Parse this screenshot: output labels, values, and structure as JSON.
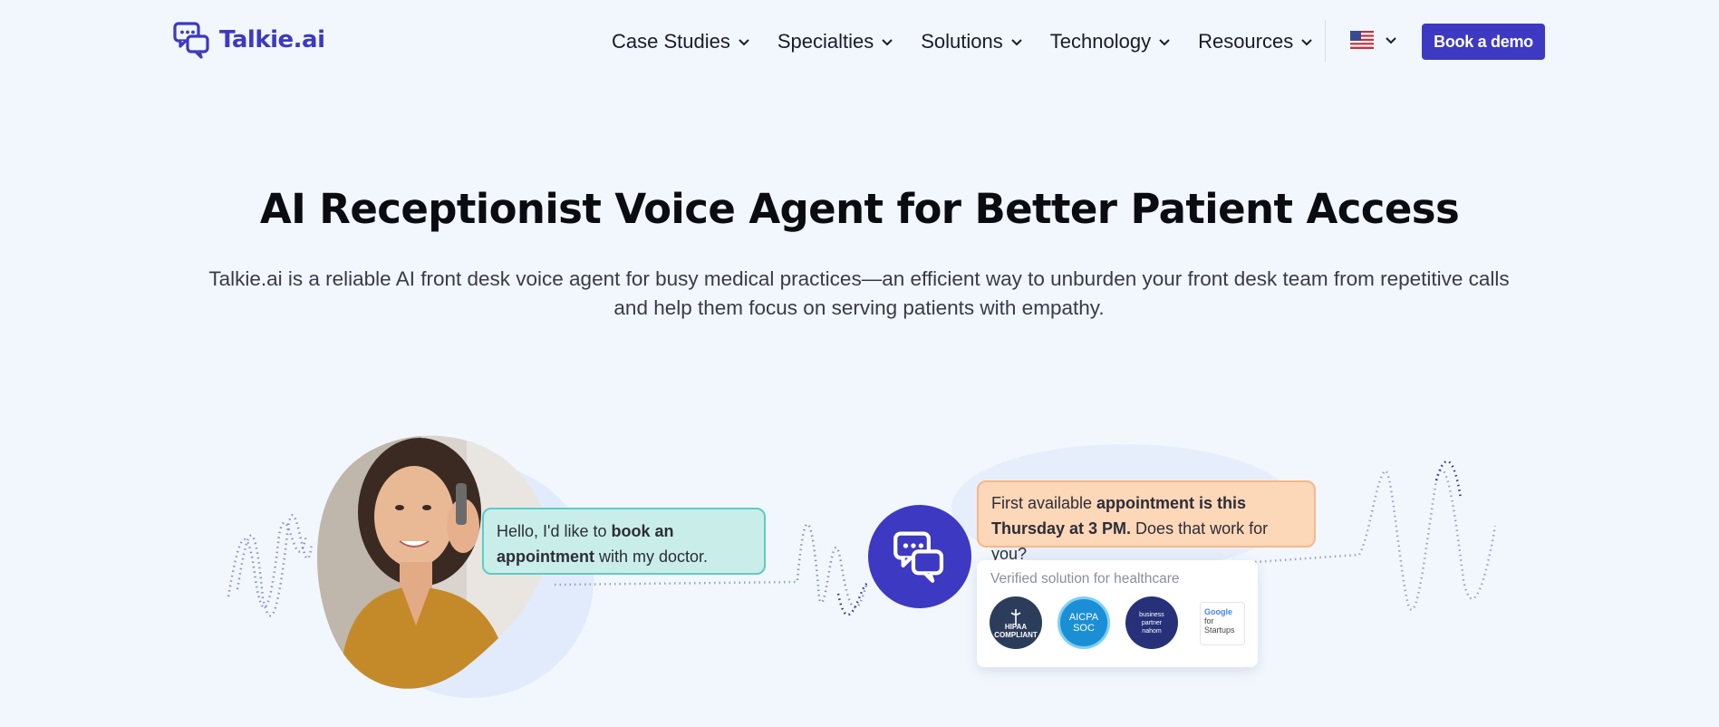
{
  "nav": {
    "logo_text": "Talkie.ai",
    "menu": [
      {
        "label": "Case Studies"
      },
      {
        "label": "Specialties"
      },
      {
        "label": "Solutions"
      },
      {
        "label": "Technology"
      },
      {
        "label": "Resources"
      }
    ],
    "language_icon": "us-flag-icon",
    "cta_label": "Book a demo"
  },
  "hero": {
    "title": "AI Receptionist Voice Agent for Better Patient Access",
    "subtitle_line1": "Talkie.ai is a reliable AI front desk voice agent for busy medical practices—an efficient way to unburden your front desk team from repetitive calls",
    "subtitle_line2": "and help them focus on serving patients with empathy."
  },
  "illustration": {
    "caller_message": {
      "pre": "Hello, I'd like to ",
      "bold": "book an appointment",
      "post": " with my doctor."
    },
    "agent_message": {
      "pre": "First available ",
      "bold": "appointment is this Thursday at 3 PM.",
      "post": " Does that work for you?"
    },
    "verified_title": "Verified solution for healthcare",
    "badges": {
      "hipaa": "HIPAA COMPLIANT",
      "aicpa": [
        "AICPA",
        "SOC"
      ],
      "drata": [
        "business",
        "partner",
        "nahom"
      ],
      "google": [
        "Google",
        "for",
        "Startups"
      ]
    }
  },
  "colors": {
    "brand": "#3d39c2",
    "background": "#f1f7fd",
    "caller_bubble": "#c9eeea",
    "agent_bubble": "#fcd7b8"
  }
}
